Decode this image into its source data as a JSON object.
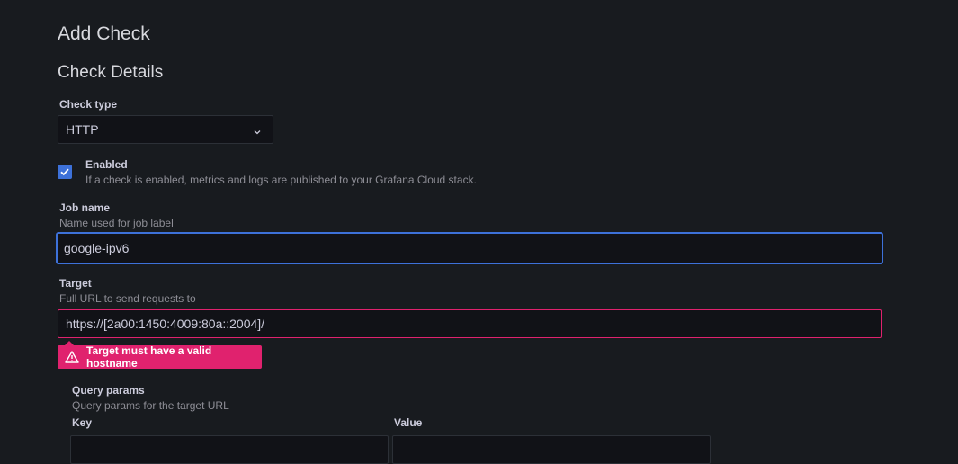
{
  "page": {
    "title": "Add Check",
    "section_title": "Check Details"
  },
  "check_type": {
    "label": "Check type",
    "value": "HTTP",
    "icon": "chevron-down-icon"
  },
  "enabled": {
    "label": "Enabled",
    "description": "If a check is enabled, metrics and logs are published to your Grafana Cloud stack.",
    "checked": true
  },
  "job_name": {
    "label": "Job name",
    "description": "Name used for job label",
    "value": "google-ipv6"
  },
  "target": {
    "label": "Target",
    "description": "Full URL to send requests to",
    "value": "https://[2a00:1450:4009:80a::2004]/",
    "error": "Target must have a valid hostname"
  },
  "query_params": {
    "label": "Query params",
    "description": "Query params for the target URL",
    "key_label": "Key",
    "value_label": "Value"
  },
  "colors": {
    "accent": "#3d71d9",
    "error": "#e0226e",
    "background": "#181b1f"
  }
}
